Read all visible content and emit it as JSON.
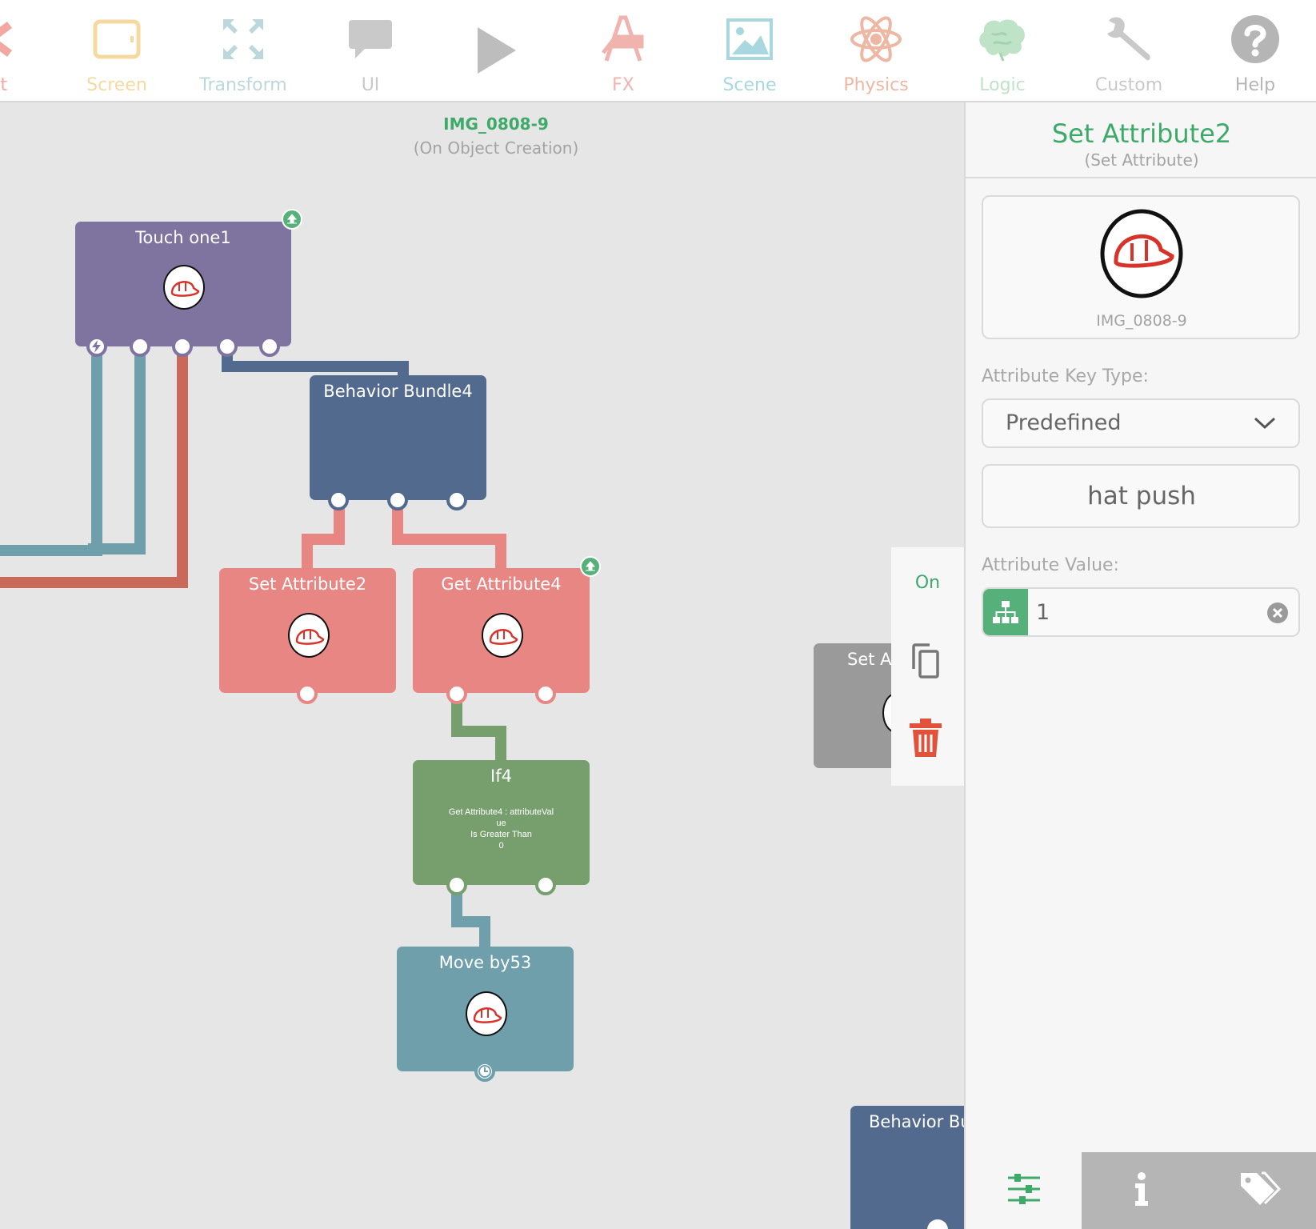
{
  "toolbar": {
    "items": [
      {
        "label": "ect",
        "icon": "object-icon",
        "color": "#f2a8a0"
      },
      {
        "label": "Screen",
        "icon": "screen-icon",
        "color": "#f6d9a0"
      },
      {
        "label": "Transform",
        "icon": "transform-icon",
        "color": "#bcd8dc"
      },
      {
        "label": "UI",
        "icon": "speech-bubble-icon",
        "color": "#c9c9c9"
      },
      {
        "label": "",
        "icon": "play-icon",
        "color": "#bdbdbd"
      },
      {
        "label": "FX",
        "icon": "fx-icon",
        "color": "#f0b3ad"
      },
      {
        "label": "Scene",
        "icon": "scene-image-icon",
        "color": "#a9d7df"
      },
      {
        "label": "Physics",
        "icon": "atom-icon",
        "color": "#eeb7a3"
      },
      {
        "label": "Logic",
        "icon": "brain-icon",
        "color": "#bfe3c7"
      },
      {
        "label": "Custom",
        "icon": "wrench-icon",
        "color": "#c9c9c9"
      },
      {
        "label": "Help",
        "icon": "help-icon",
        "color": "#b5b5b5"
      }
    ]
  },
  "canvas": {
    "object_name": "IMG_0808-9",
    "trigger": "(On Object Creation)",
    "nodes": {
      "touch": {
        "title": "Touch one1"
      },
      "bundle": {
        "title": "Behavior Bundle4"
      },
      "set_attr": {
        "title": "Set Attribute2"
      },
      "get_attr": {
        "title": "Get Attribute4"
      },
      "if": {
        "title": "If4",
        "condition_line1": "Get Attribute4 : attributeVal",
        "condition_line2": "ue",
        "condition_line3": "Is Greater Than",
        "condition_line4": "0"
      },
      "move": {
        "title": "Move by53"
      },
      "partial_set": {
        "title": "Set At"
      },
      "partial_bundle": {
        "title": "Behavior Bu"
      }
    },
    "context_menu": {
      "on_label": "On"
    }
  },
  "panel": {
    "title": "Set Attribute2",
    "subtitle": "(Set Attribute)",
    "object_name": "IMG_0808-9",
    "key_type_label": "Attribute Key Type:",
    "key_type_value": "Predefined",
    "key_value": "hat push",
    "value_label": "Attribute Value:",
    "value": "1"
  },
  "colors": {
    "accent_green": "#3daa6a",
    "purple": "#7f73a0",
    "navy": "#536a8f",
    "salmon": "#e88684",
    "green": "#779f6d",
    "teal": "#6e9fab",
    "red": "#e0533a"
  }
}
